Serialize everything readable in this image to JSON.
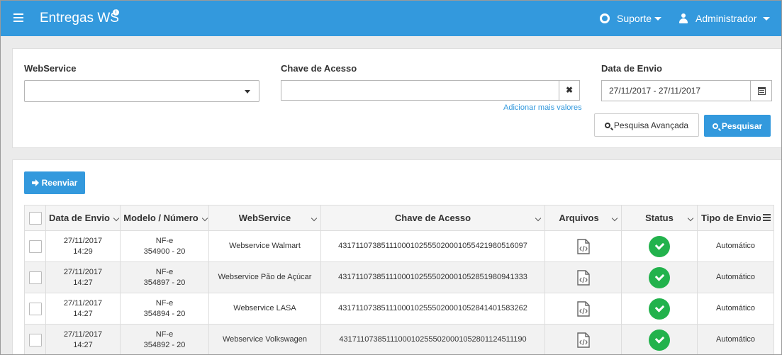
{
  "header": {
    "title": "Entregas WS",
    "info_glyph": "i",
    "support_label": "Suporte",
    "user_label": "Administrador"
  },
  "filters": {
    "webservice_label": "WebService",
    "webservice_value": "",
    "chave_label": "Chave de Acesso",
    "chave_value": "",
    "clear_glyph": "✖",
    "add_values_link": "Adicionar mais valores",
    "date_label": "Data de Envio",
    "date_value": "27/11/2017 - 27/11/2017",
    "advanced_search_label": "Pesquisa Avançada",
    "search_label": "Pesquisar"
  },
  "results": {
    "resend_label": "Reenviar",
    "columns": [
      "Data de Envio",
      "Modelo / Número",
      "WebService",
      "Chave de Acesso",
      "Arquivos",
      "Status",
      "Tipo de Envio"
    ],
    "rows": [
      {
        "date": "27/11/2017",
        "time": "14:29",
        "model": "NF-e",
        "number": "354900 - 20",
        "webservice": "Webservice Walmart",
        "key": "43171107385111000102555020001055421980516097",
        "type": "Automático"
      },
      {
        "date": "27/11/2017",
        "time": "14:27",
        "model": "NF-e",
        "number": "354897 - 20",
        "webservice": "Webservice Pão de Açúcar",
        "key": "43171107385111000102555020001052851980941333",
        "type": "Automático"
      },
      {
        "date": "27/11/2017",
        "time": "14:27",
        "model": "NF-e",
        "number": "354894 - 20",
        "webservice": "Webservice LASA",
        "key": "43171107385111000102555020001052841401583262",
        "type": "Automático"
      },
      {
        "date": "27/11/2017",
        "time": "14:27",
        "model": "NF-e",
        "number": "354892 - 20",
        "webservice": "Webservice Volkswagen",
        "key": "43171107385111000102555020001052801124511190",
        "type": "Automático"
      }
    ]
  },
  "colors": {
    "brand": "#3399dd",
    "success": "#22b24c"
  }
}
